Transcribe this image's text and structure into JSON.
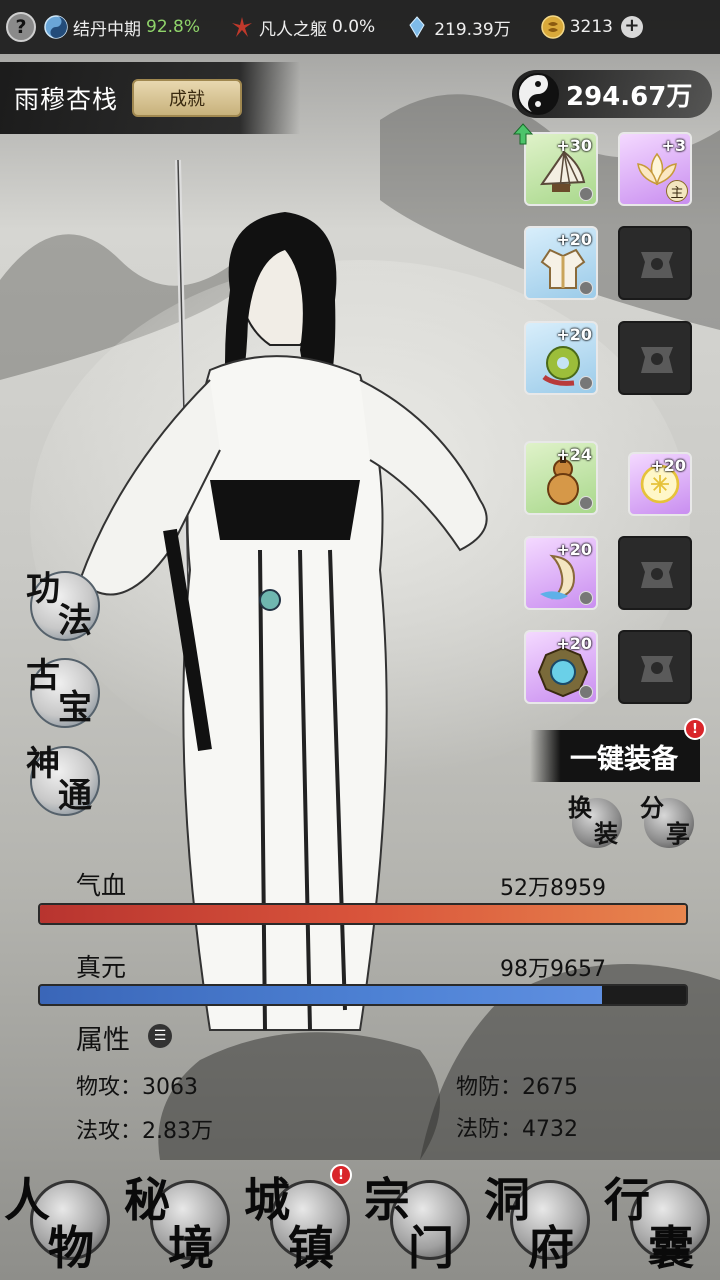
{
  "topbar": {
    "realm": "结丹中期",
    "realm_progress": "92.8%",
    "body_stage": "凡人之躯",
    "body_progress": "0.0%",
    "spirit_stones": "219.39万",
    "gold": "3213"
  },
  "location": {
    "name": "雨穆杏栈",
    "achievement_label": "成就"
  },
  "power": "294.67万",
  "equipment": {
    "slots": [
      {
        "level": "+30",
        "icon": "fan-icon"
      },
      {
        "level": "+3",
        "icon": "lotus-icon",
        "tag": "主"
      },
      {
        "level": "+20",
        "icon": "robe-icon"
      },
      {
        "level": "+20",
        "icon": "jade-pendant-icon"
      },
      {
        "level": "+24",
        "icon": "gourd-icon"
      },
      {
        "level": "+20",
        "icon": "glowing-talisman-icon"
      },
      {
        "level": "+20",
        "icon": "scroll-icon"
      },
      {
        "level": "+20",
        "icon": "bagua-mirror-icon"
      }
    ]
  },
  "skills": [
    {
      "t1": "功",
      "t2": "法"
    },
    {
      "t1": "古",
      "t2": "宝"
    },
    {
      "t1": "神",
      "t2": "通"
    }
  ],
  "actions": {
    "one_key_equip": "一键装备",
    "one_key_badge": "!",
    "swap": {
      "t1": "换",
      "t2": "装"
    },
    "share": {
      "t1": "分",
      "t2": "享"
    }
  },
  "vitals": {
    "hp_label": "气血",
    "hp_value": "52万8959",
    "hp_fill": 1.0,
    "mp_label": "真元",
    "mp_value": "98万9657",
    "mp_fill": 0.87
  },
  "attributes": {
    "title": "属性",
    "phys_atk": "物攻：3063",
    "phys_def": "物防：2675",
    "mag_atk": "法攻：2.83万",
    "mag_def": "法防：4732"
  },
  "nav": [
    {
      "t1": "人",
      "t2": "物"
    },
    {
      "t1": "秘",
      "t2": "境"
    },
    {
      "t1": "城",
      "t2": "镇",
      "badge": "!"
    },
    {
      "t1": "宗",
      "t2": "门"
    },
    {
      "t1": "洞",
      "t2": "府"
    },
    {
      "t1": "行",
      "t2": "囊"
    }
  ],
  "colors": {
    "hp_bar": "#d9543b",
    "mp_bar": "#4d81d4",
    "realm_progress": "#8fd36a",
    "badge": "#d9252a"
  }
}
